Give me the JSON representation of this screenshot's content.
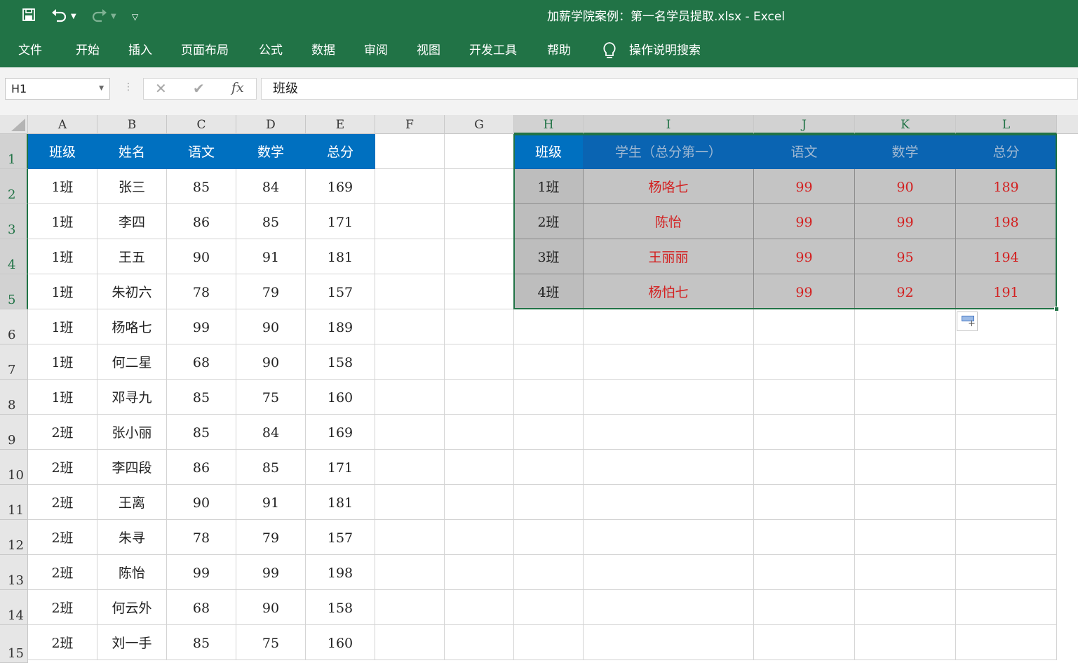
{
  "titlebar": {
    "title": "加薪学院案例：第一名学员提取.xlsx  -  Excel",
    "save_icon": "save-icon",
    "undo_icon": "undo-icon",
    "redo_icon": "redo-icon",
    "customize_icon": "customize-qat-icon"
  },
  "ribbon": {
    "tabs": [
      "文件",
      "开始",
      "插入",
      "页面布局",
      "公式",
      "数据",
      "审阅",
      "视图",
      "开发工具",
      "帮助"
    ],
    "tell_me": "操作说明搜索"
  },
  "formula_bar": {
    "name_box": "H1",
    "fx_label": "fx",
    "content": "班级"
  },
  "columns": [
    "A",
    "B",
    "C",
    "D",
    "E",
    "F",
    "G",
    "H",
    "I",
    "J",
    "K",
    "L"
  ],
  "rows": [
    "1",
    "2",
    "3",
    "4",
    "5",
    "6",
    "7",
    "8",
    "9",
    "10",
    "11",
    "12",
    "13",
    "14",
    "15"
  ],
  "source_table": {
    "headers": [
      "班级",
      "姓名",
      "语文",
      "数学",
      "总分"
    ],
    "rows": [
      [
        "1班",
        "张三",
        "85",
        "84",
        "169"
      ],
      [
        "1班",
        "李四",
        "86",
        "85",
        "171"
      ],
      [
        "1班",
        "王五",
        "90",
        "91",
        "181"
      ],
      [
        "1班",
        "朱初六",
        "78",
        "79",
        "157"
      ],
      [
        "1班",
        "杨咯七",
        "99",
        "90",
        "189"
      ],
      [
        "1班",
        "何二星",
        "68",
        "90",
        "158"
      ],
      [
        "1班",
        "邓寻九",
        "85",
        "75",
        "160"
      ],
      [
        "2班",
        "张小丽",
        "85",
        "84",
        "169"
      ],
      [
        "2班",
        "李四段",
        "86",
        "85",
        "171"
      ],
      [
        "2班",
        "王离",
        "90",
        "91",
        "181"
      ],
      [
        "2班",
        "朱寻",
        "78",
        "79",
        "157"
      ],
      [
        "2班",
        "陈怡",
        "99",
        "99",
        "198"
      ],
      [
        "2班",
        "何云外",
        "68",
        "90",
        "158"
      ],
      [
        "2班",
        "刘一手",
        "85",
        "75",
        "160"
      ]
    ]
  },
  "result_table": {
    "headers": [
      "班级",
      "学生（总分第一）",
      "语文",
      "数学",
      "总分"
    ],
    "rows": [
      [
        "1班",
        "杨咯七",
        "99",
        "90",
        "189"
      ],
      [
        "2班",
        "陈怡",
        "99",
        "99",
        "198"
      ],
      [
        "3班",
        "王丽丽",
        "99",
        "95",
        "194"
      ],
      [
        "4班",
        "杨怕七",
        "99",
        "92",
        "191"
      ]
    ]
  },
  "colors": {
    "excel_green": "#217346",
    "header_blue": "#0070c0",
    "highlight_red": "#d32020"
  }
}
